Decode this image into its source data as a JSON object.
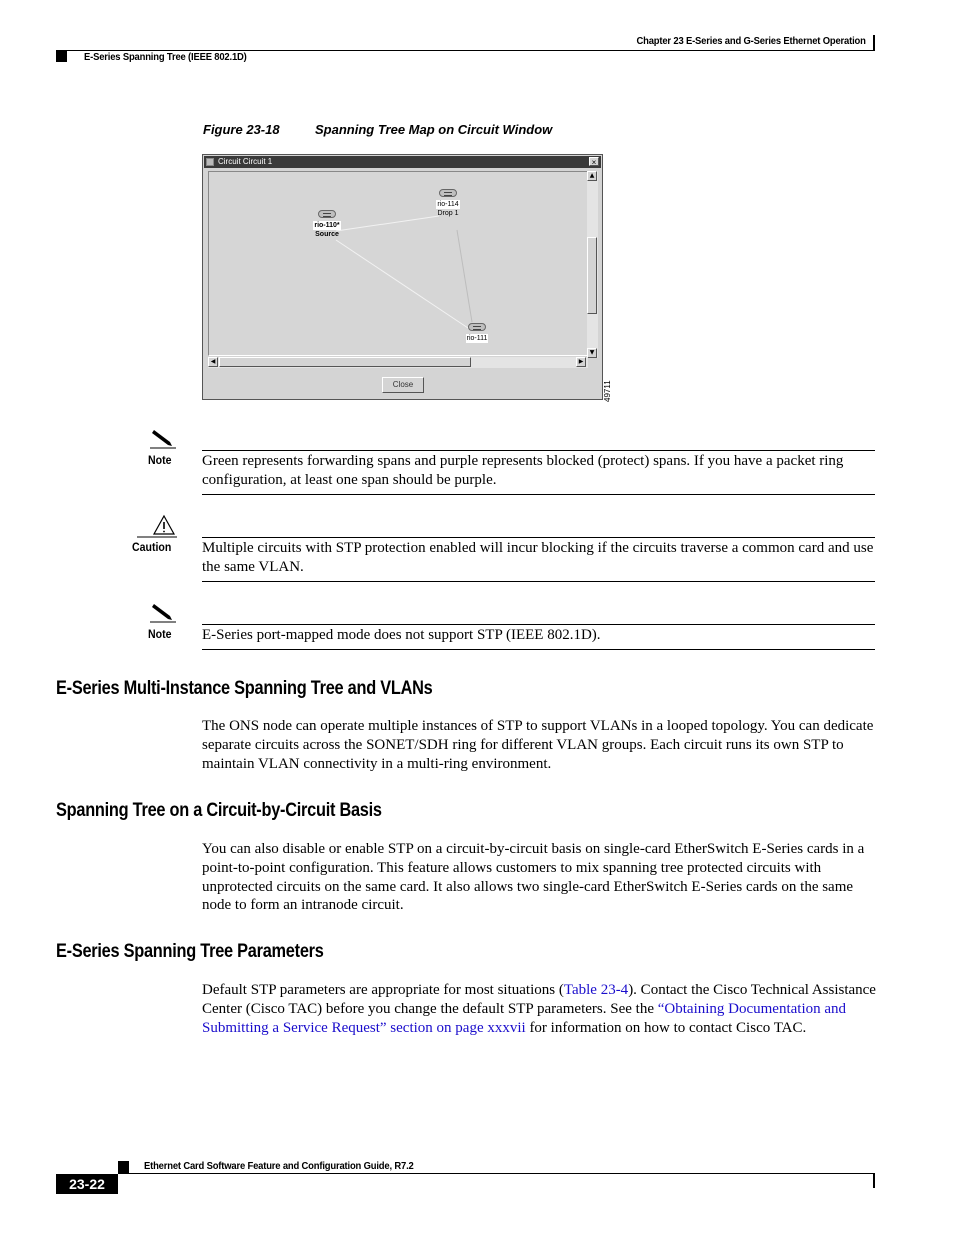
{
  "header": {
    "chapter": "Chapter 23 E-Series and G-Series Ethernet Operation",
    "section": "E-Series Spanning Tree (IEEE 802.1D)"
  },
  "figure": {
    "number": "Figure 23-18",
    "title": "Spanning Tree Map on Circuit Window",
    "id": "49711",
    "window": {
      "title": "Circuit  Circuit 1",
      "close_glyph": "×",
      "close_button": "Close",
      "nodes": [
        {
          "label": "rio-110*",
          "role": "Source"
        },
        {
          "label": "rio-114",
          "role": "Drop 1"
        },
        {
          "label": "rio-111",
          "role": ""
        }
      ]
    }
  },
  "admonitions": [
    {
      "type": "Note",
      "icon": "pencil-icon",
      "text": "Green represents forwarding spans and purple represents blocked (protect) spans. If you have a packet ring configuration, at least one span should be purple."
    },
    {
      "type": "Caution",
      "icon": "warning-triangle-icon",
      "text": "Multiple circuits with STP protection enabled will incur blocking if the circuits traverse a common card and use the same VLAN."
    },
    {
      "type": "Note",
      "icon": "pencil-icon",
      "text": "E-Series port-mapped mode does not support STP (IEEE 802.1D)."
    }
  ],
  "sections": [
    {
      "heading": "E-Series Multi-Instance Spanning Tree and VLANs",
      "body": "The ONS node can operate multiple instances of STP to support VLANs in a looped topology. You can dedicate separate circuits across the SONET/SDH ring for different VLAN groups. Each circuit runs its own STP to maintain VLAN connectivity in a multi-ring environment."
    },
    {
      "heading": "Spanning Tree on a Circuit-by-Circuit Basis",
      "body": "You can also disable or enable STP on a circuit-by-circuit basis on single-card EtherSwitch E-Series cards in a point-to-point configuration. This feature allows customers to mix spanning tree protected circuits with unprotected circuits on the same card. It also allows two single-card EtherSwitch E-Series cards on the same node to form an intranode circuit."
    },
    {
      "heading": "E-Series Spanning Tree Parameters",
      "body_parts": {
        "p1": "Default STP parameters are appropriate for most situations (",
        "link1": "Table 23-4",
        "p2": "). Contact the Cisco Technical Assistance Center (Cisco TAC) before you change the default STP parameters. See the ",
        "link2": "“Obtaining Documentation and Submitting a Service Request” section on page xxxvii",
        "p3": " for information on how to contact Cisco TAC."
      }
    }
  ],
  "footer": {
    "title": "Ethernet Card Software Feature and Configuration Guide, R7.2",
    "page": "23-22"
  },
  "colors": {
    "link": "#1a0dcc",
    "window_titlebar": "#3a3a3a",
    "window_bg": "#d4d4d4"
  }
}
